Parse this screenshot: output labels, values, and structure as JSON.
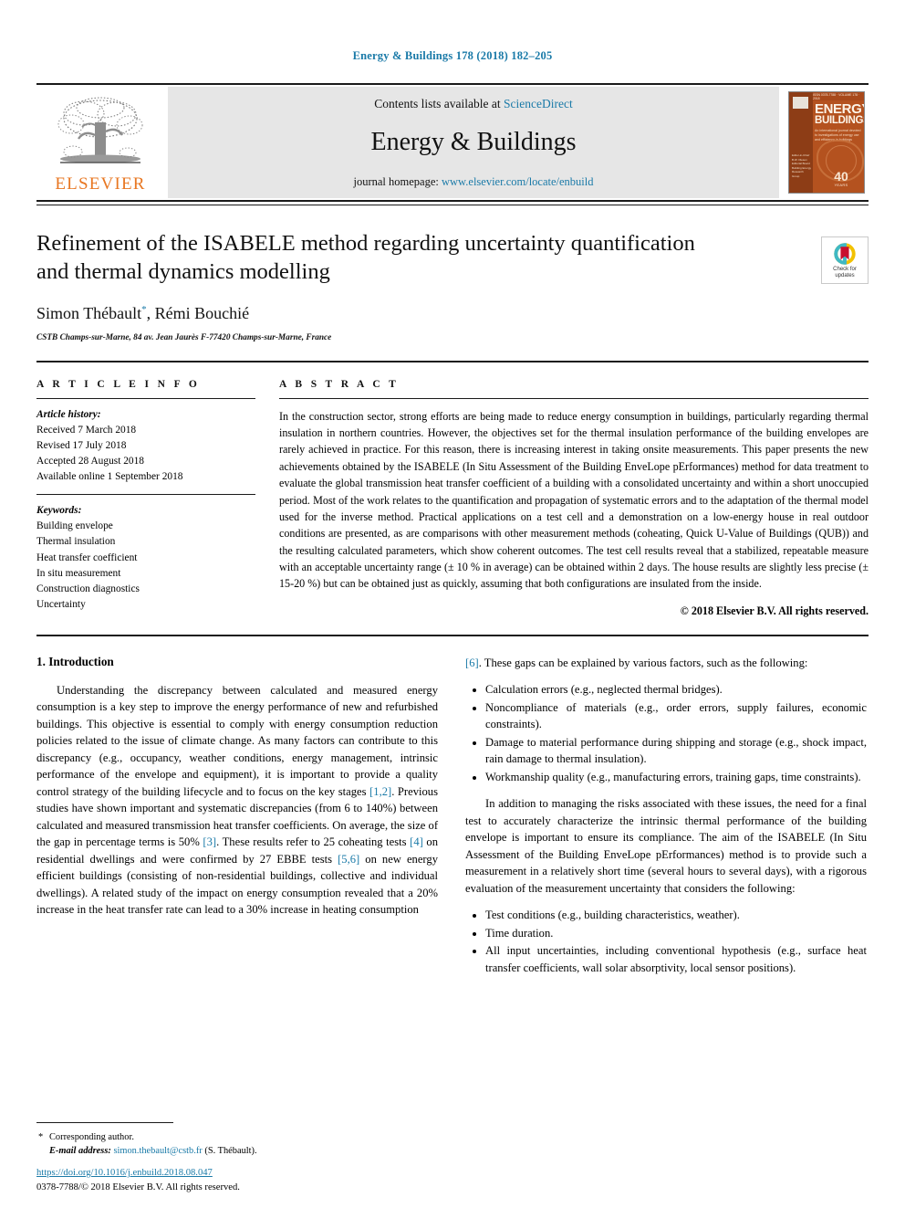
{
  "running_head": "Energy & Buildings 178 (2018) 182–205",
  "masthead": {
    "publisher": "ELSEVIER",
    "contents_prefix": "Contents lists available at ",
    "contents_link": "ScienceDirect",
    "journal_name": "Energy & Buildings",
    "homepage_prefix": "journal homepage: ",
    "homepage_link": "www.elsevier.com/locate/enbuild",
    "cover": {
      "top_rule": "ISSN 0378-7788 · VOLUME 178 · 2018",
      "title_line1": "ENERGY",
      "title_line2": "BUILDINGS",
      "and_word": "and",
      "subtitle": "An international journal devoted to investigations of energy use and efficiency in buildings",
      "anniversary_number": "40",
      "anniversary_label": "YEARS",
      "editors": "Editor-in-Chief\nB.W. Olesen\nEditorial Board\nBuilding Energy\nResearch Group"
    }
  },
  "article": {
    "title": "Refinement of the ISABELE method regarding uncertainty quantification and thermal dynamics modelling",
    "authors": "Simon Thébault, Rémi Bouchié",
    "author_marker": "*",
    "affiliation": "CSTB Champs-sur-Marne, 84 av. Jean Jaurès F-77420 Champs-sur-Marne, France",
    "crossmark_line1": "Check for",
    "crossmark_line2": "updates"
  },
  "article_info": {
    "label": "A R T I C L E    I N F O",
    "history_heading": "Article history:",
    "history": [
      "Received 7 March 2018",
      "Revised 17 July 2018",
      "Accepted 28 August 2018",
      "Available online 1 September 2018"
    ],
    "keywords_heading": "Keywords:",
    "keywords": [
      "Building envelope",
      "Thermal insulation",
      "Heat transfer coefficient",
      "In situ measurement",
      "Construction diagnostics",
      "Uncertainty"
    ]
  },
  "abstract": {
    "label": "A B S T R A C T",
    "text": "In the construction sector, strong efforts are being made to reduce energy consumption in buildings, particularly regarding thermal insulation in northern countries. However, the objectives set for the thermal insulation performance of the building envelopes are rarely achieved in practice. For this reason, there is increasing interest in taking onsite measurements. This paper presents the new achievements obtained by the ISABELE (In Situ Assessment of the Building EnveLope pErformances) method for data treatment to evaluate the global transmission heat transfer coefficient of a building with a consolidated uncertainty and within a short unoccupied period. Most of the work relates to the quantification and propagation of systematic errors and to the adaptation of the thermal model used for the inverse method. Practical applications on a test cell and a demonstration on a low-energy house in real outdoor conditions are presented, as are comparisons with other measurement methods (coheating, Quick U-Value of Buildings (QUB)) and the resulting calculated parameters, which show coherent outcomes. The test cell results reveal that a stabilized, repeatable measure with an acceptable uncertainty range (± 10 % in average) can be obtained within 2 days. The house results are slightly less precise (± 15-20 %) but can be obtained just as quickly, assuming that both configurations are insulated from the inside.",
    "copyright": "© 2018 Elsevier B.V. All rights reserved."
  },
  "introduction": {
    "heading": "1. Introduction",
    "left_para_1_a": "Understanding the discrepancy between calculated and measured energy consumption is a key step to improve the energy performance of new and refurbished buildings. This objective is essential to comply with energy consumption reduction policies related to the issue of climate change. As many factors can contribute to this discrepancy (e.g., occupancy, weather conditions, energy management, intrinsic performance of the envelope and equipment), it is important to provide a quality control strategy of the building lifecycle and to focus on the key stages ",
    "ref_1_2": "[1,2]",
    "left_para_1_b": ". Previous studies have shown important and systematic discrepancies (from 6 to 140%) between calculated and measured transmission heat transfer coefficients. On average, the size of the gap in percentage terms is 50% ",
    "ref_3": "[3]",
    "left_para_1_c": ". These results refer to 25 coheating tests ",
    "ref_4": "[4]",
    "left_para_1_d": " on residential dwellings and were confirmed by 27 EBBE tests ",
    "ref_5_6": "[5,6]",
    "left_para_1_e": " on new energy efficient buildings (consisting of non-residential buildings, collective and individual dwellings). A related study of the impact on energy consumption revealed that a 20% increase in the heat transfer rate can lead to a 30% increase in heating consumption ",
    "ref_6": "[6]",
    "right_para_1": ". These gaps can be explained by various factors, such as the following:",
    "bullets_1": [
      "Calculation errors (e.g., neglected thermal bridges).",
      "Noncompliance of materials (e.g., order errors, supply failures, economic constraints).",
      "Damage to material performance during shipping and storage (e.g., shock impact, rain damage to thermal insulation).",
      "Workmanship quality (e.g., manufacturing errors, training gaps, time constraints)."
    ],
    "right_para_2": "In addition to managing the risks associated with these issues, the need for a final test to accurately characterize the intrinsic thermal performance of the building envelope is important to ensure its compliance. The aim of the ISABELE (In Situ Assessment of the Building EnveLope pErformances) method is to provide such a measurement in a relatively short time (several hours to several days), with a rigorous evaluation of the measurement uncertainty that considers the following:",
    "bullets_2": [
      "Test conditions (e.g., building characteristics, weather).",
      "Time duration.",
      "All input uncertainties, including conventional hypothesis (e.g., surface heat transfer coefficients, wall solar absorptivity, local sensor positions)."
    ]
  },
  "footer": {
    "corresponding_marker": "*",
    "corresponding_author": "Corresponding author.",
    "email_label": "E-mail address:",
    "email": "simon.thebault@cstb.fr",
    "email_suffix": "(S. Thébault).",
    "doi": "https://doi.org/10.1016/j.enbuild.2018.08.047",
    "issn_line": "0378-7788/© 2018 Elsevier B.V. All rights reserved."
  },
  "colors": {
    "link_blue": "#1a7aa8",
    "elsevier_orange": "#E87722",
    "masthead_gray": "#e6e6e6",
    "cover_orange": "#b4521f"
  }
}
